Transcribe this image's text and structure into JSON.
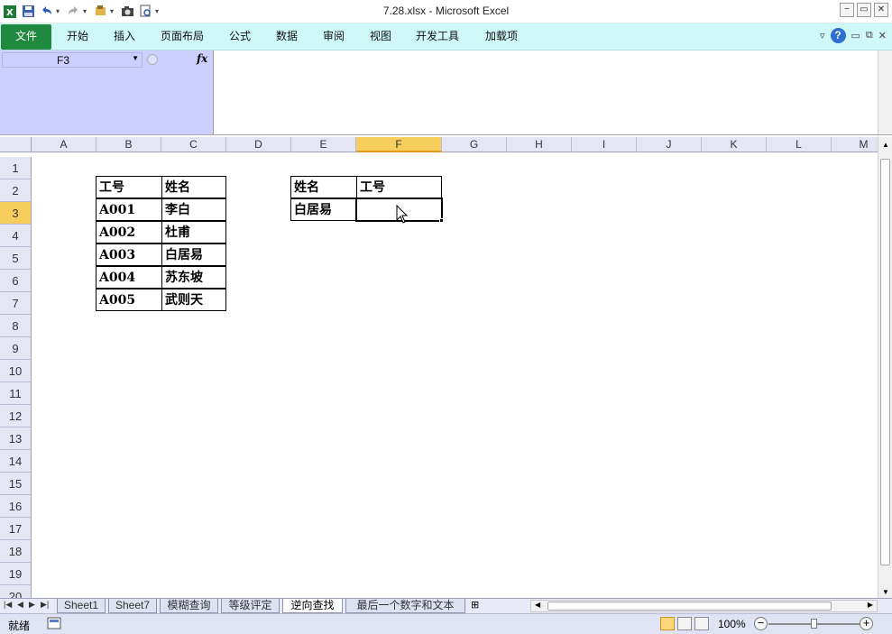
{
  "window": {
    "title": "7.28.xlsx - Microsoft Excel",
    "controls": [
      "−",
      "▭",
      "✕"
    ]
  },
  "ribbon": {
    "tabs": [
      "文件",
      "开始",
      "插入",
      "页面布局",
      "公式",
      "数据",
      "审阅",
      "视图",
      "开发工具",
      "加载项"
    ]
  },
  "formula_bar": {
    "name_box": "F3",
    "fx_label": "fx",
    "formula": ""
  },
  "columns": [
    "A",
    "B",
    "C",
    "D",
    "E",
    "F",
    "G",
    "H",
    "I",
    "J",
    "K",
    "L",
    "M"
  ],
  "rows": [
    "1",
    "2",
    "3",
    "4",
    "5",
    "6",
    "7",
    "8",
    "9",
    "10",
    "11",
    "12",
    "13",
    "14",
    "15",
    "16",
    "17",
    "18",
    "19",
    "20"
  ],
  "selected": {
    "column": "F",
    "row": "3"
  },
  "source_table": {
    "header": [
      "工号",
      "姓名"
    ],
    "rows": [
      [
        "A001",
        "李白"
      ],
      [
        "A002",
        "杜甫"
      ],
      [
        "A003",
        "白居易"
      ],
      [
        "A004",
        "苏东坡"
      ],
      [
        "A005",
        "武则天"
      ]
    ]
  },
  "lookup_table": {
    "header": [
      "姓名",
      "工号"
    ],
    "row": [
      "白居易",
      ""
    ]
  },
  "sheet_tabs": [
    "Sheet1",
    "Sheet7",
    "模糊查询",
    "等级评定",
    "逆向查找",
    "最后一个数字和文本"
  ],
  "active_sheet": "逆向查找",
  "status": {
    "ready": "就绪",
    "zoom": "100%"
  },
  "colors": {
    "ribbon_bg": "#cff9f7",
    "file_tab": "#1f8a3f",
    "namebox_panel": "#cdd0ff",
    "selected_header": "#f7cd5e"
  }
}
